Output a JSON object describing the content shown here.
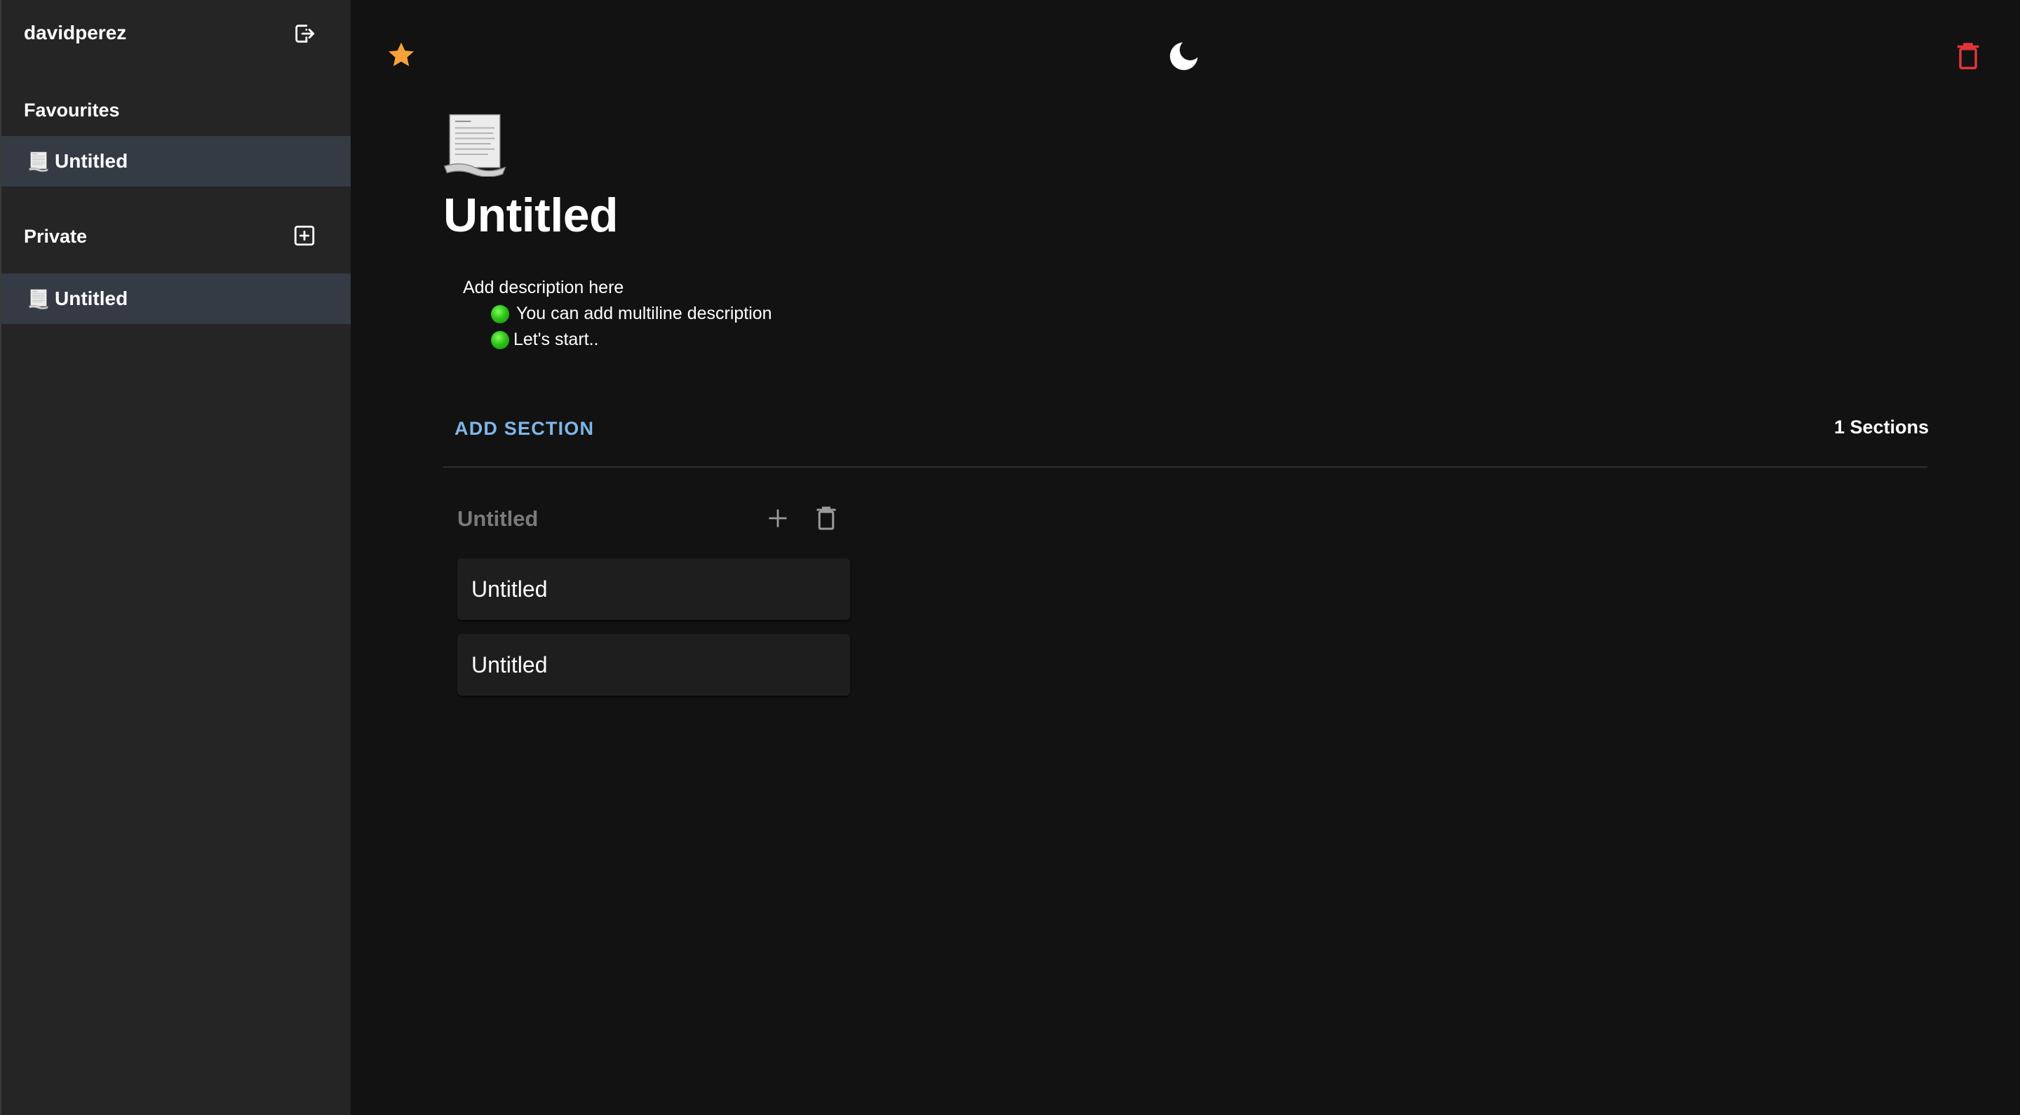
{
  "sidebar": {
    "username": "davidperez",
    "favourites": {
      "title": "Favourites",
      "items": [
        {
          "icon": "scroll-doc-emoji",
          "label": "Untitled"
        }
      ]
    },
    "private": {
      "title": "Private",
      "items": [
        {
          "icon": "scroll-doc-emoji",
          "label": "Untitled"
        }
      ]
    }
  },
  "page": {
    "icon": "scroll-doc-emoji",
    "title": "Untitled",
    "description": {
      "line1": "Add description here",
      "line2": "You can add multiline description",
      "line3": "Let's start.."
    }
  },
  "toolbar": {
    "favourite_active": true,
    "star_color": "#f5a23a",
    "trash_color": "#e5363a"
  },
  "board": {
    "add_section_label": "ADD SECTION",
    "section_count_label": "1 Sections",
    "sections": [
      {
        "title": "Untitled",
        "cards": [
          {
            "title": "Untitled"
          },
          {
            "title": "Untitled"
          }
        ]
      }
    ]
  },
  "colors": {
    "sidebar_bg": "#252525",
    "selected_item_bg": "#343b45",
    "main_bg": "#121212",
    "accent_link": "#7fb6e8",
    "card_bg": "#1e1e1e"
  }
}
